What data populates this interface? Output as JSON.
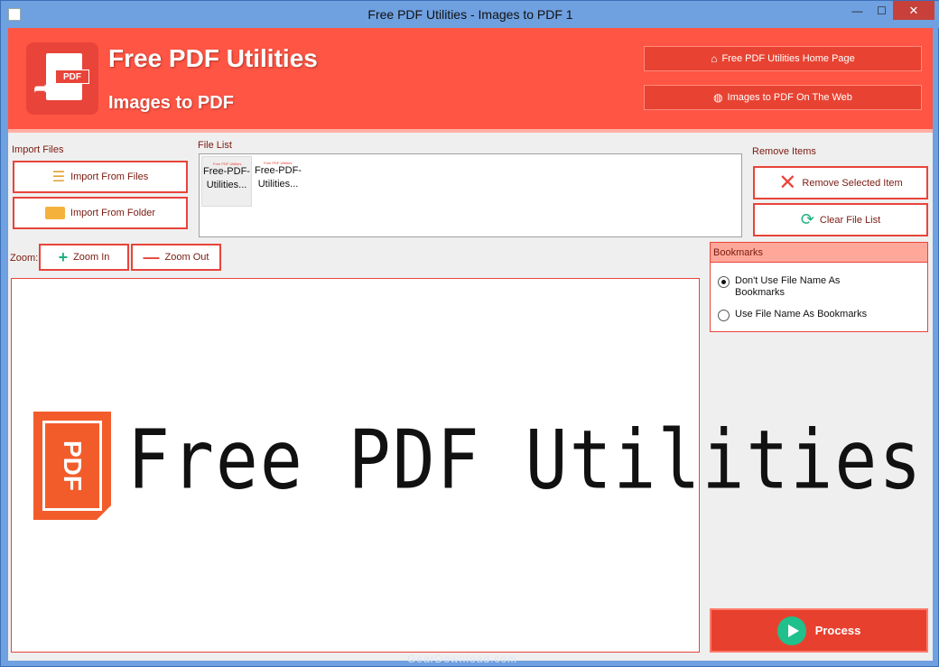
{
  "window": {
    "title": "Free PDF Utilities - Images to PDF 1",
    "minimize_glyph": "—",
    "maximize_glyph": "☐",
    "close_glyph": "✕"
  },
  "header": {
    "title": "Free PDF Utilities",
    "subtitle": "Images to PDF",
    "logo_label": "PDF",
    "home_link": "Free PDF Utilities Home Page",
    "web_link": "Images to PDF On The Web",
    "accent_color": "#ff5544"
  },
  "import": {
    "label": "Import Files",
    "from_files": "Import From Files",
    "from_folder": "Import From Folder"
  },
  "file_list": {
    "label": "File List",
    "items": [
      {
        "thumb": "Free PDF Utilities",
        "name": "Free-PDF-Utilities..."
      },
      {
        "thumb": "Free PDF Utilities",
        "name": "Free-PDF-Utilities..."
      }
    ]
  },
  "remove": {
    "label": "Remove Items",
    "remove_selected": "Remove Selected Item",
    "clear_list": "Clear File List"
  },
  "zoom": {
    "label": "Zoom:",
    "zoom_in": "Zoom In",
    "zoom_out": "Zoom Out"
  },
  "preview": {
    "logo_box_text": "PDF",
    "logo_text": "Free PDF Utilities"
  },
  "bookmarks": {
    "label": "Bookmarks",
    "option_no_filename": "Don't Use File Name As Bookmarks",
    "option_filename": "Use File Name As Bookmarks",
    "selected": "option_no_filename"
  },
  "process": {
    "label": "Process"
  },
  "watermark": "GearDownload.com"
}
